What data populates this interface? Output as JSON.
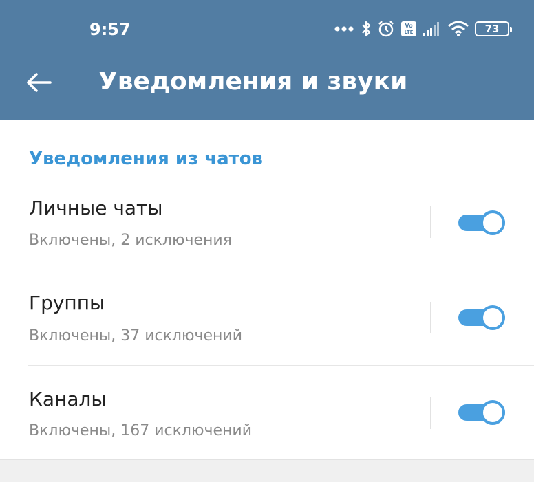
{
  "status_bar": {
    "time": "9:57",
    "battery": "73",
    "icons": [
      "more-dots-icon",
      "bluetooth-icon",
      "alarm-icon",
      "volte-icon",
      "signal-icon",
      "wifi-icon",
      "battery-icon"
    ]
  },
  "app_bar": {
    "title": "Уведомления и звуки",
    "back_icon": "arrow-left-icon",
    "background": "#527da3"
  },
  "section": {
    "header": "Уведомления из чатов",
    "accent": "#3a95d5",
    "items": [
      {
        "title": "Личные чаты",
        "subtitle": "Включены, 2 исключения",
        "enabled": true
      },
      {
        "title": "Группы",
        "subtitle": "Включены, 37 исключений",
        "enabled": true
      },
      {
        "title": "Каналы",
        "subtitle": "Включены, 167 исключений",
        "enabled": true
      }
    ]
  },
  "colors": {
    "toggle_on": "#4aa0e0",
    "subtitle": "#8a8a8a"
  }
}
